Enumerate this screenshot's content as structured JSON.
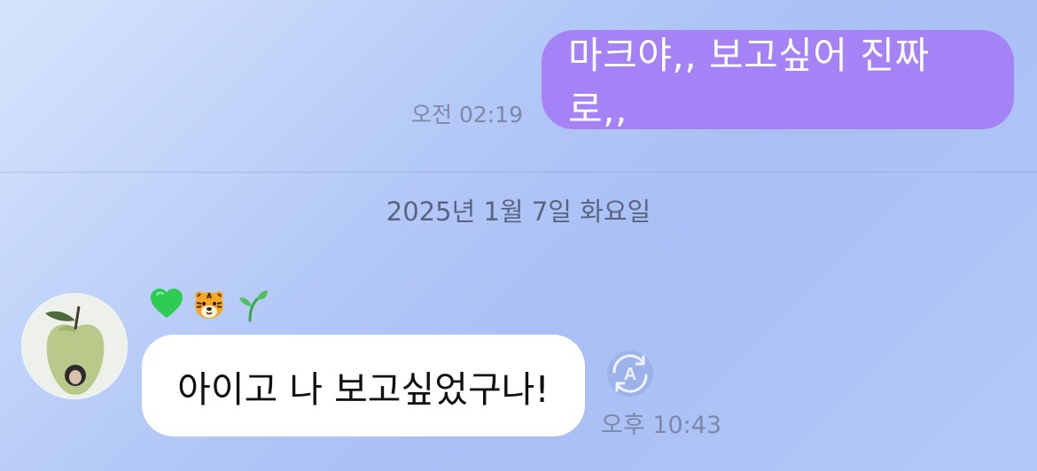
{
  "messages": {
    "outgoing": {
      "text": "마크야,, 보고싶어 진짜로,,",
      "time": "오전 02:19"
    },
    "date_separator": "2025년 1월 7일 화요일",
    "incoming": {
      "text": "아이고 나 보고싶었구나!",
      "time": "오후 10:43",
      "reactions": [
        "green-heart-icon",
        "tiger-face-icon",
        "seedling-icon"
      ]
    }
  },
  "colors": {
    "outgoing_bubble": "#a583f6",
    "incoming_bubble": "#ffffff",
    "timestamp": "#7d88a9",
    "date_text": "#5a6380"
  }
}
